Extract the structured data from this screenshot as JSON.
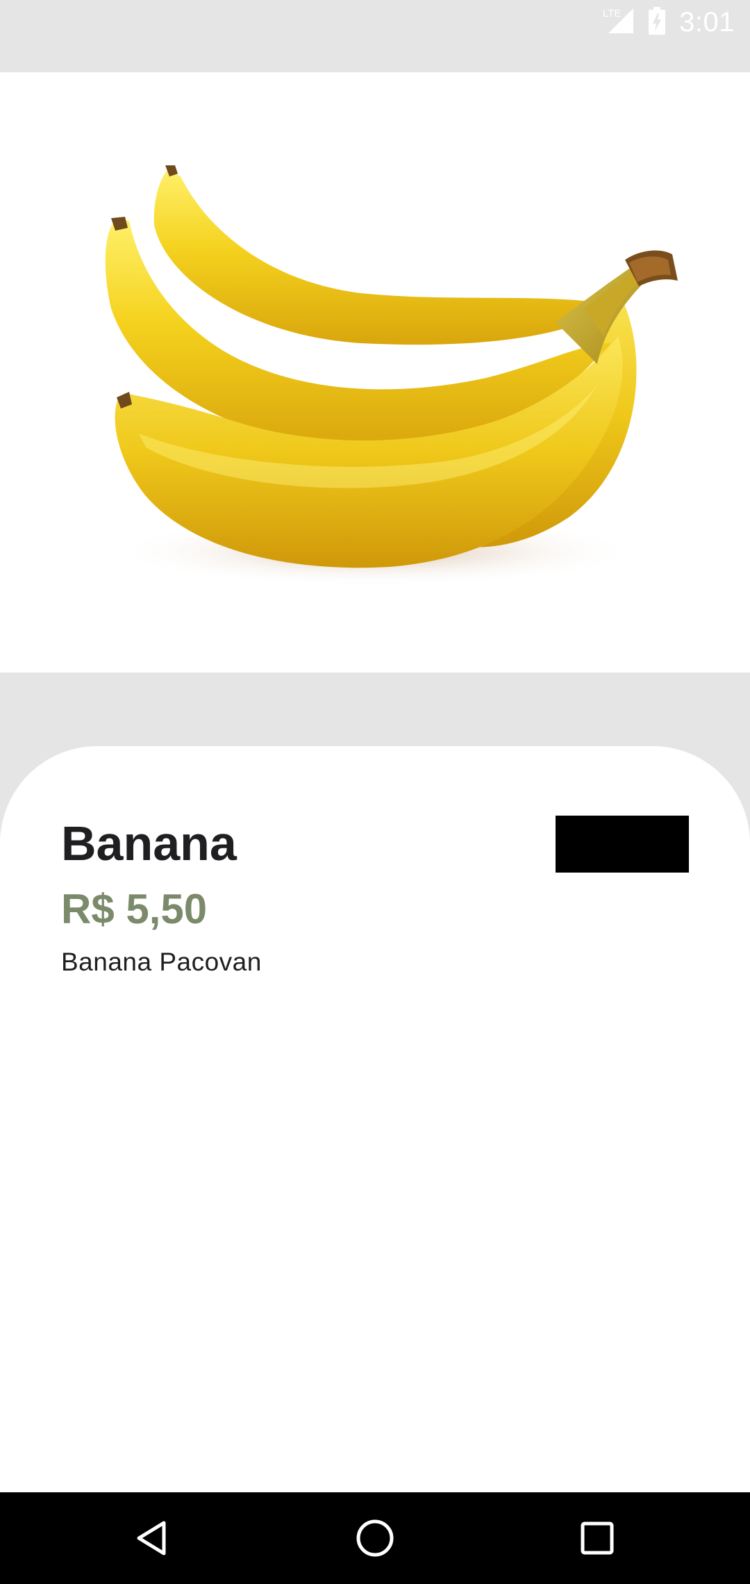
{
  "status_bar": {
    "network_label": "LTE",
    "time": "3:01",
    "icons": [
      "lte-signal-icon",
      "battery-charging-icon"
    ]
  },
  "product": {
    "image": "banana-bunch-image",
    "name": "Banana",
    "price": "R$ 5,50",
    "description": "Banana Pacovan",
    "price_color": "#7a8a6a"
  },
  "action_button": {
    "label": "",
    "color": "#000000"
  },
  "nav_bar": {
    "icons": [
      "back-icon",
      "home-icon",
      "recents-icon"
    ]
  }
}
